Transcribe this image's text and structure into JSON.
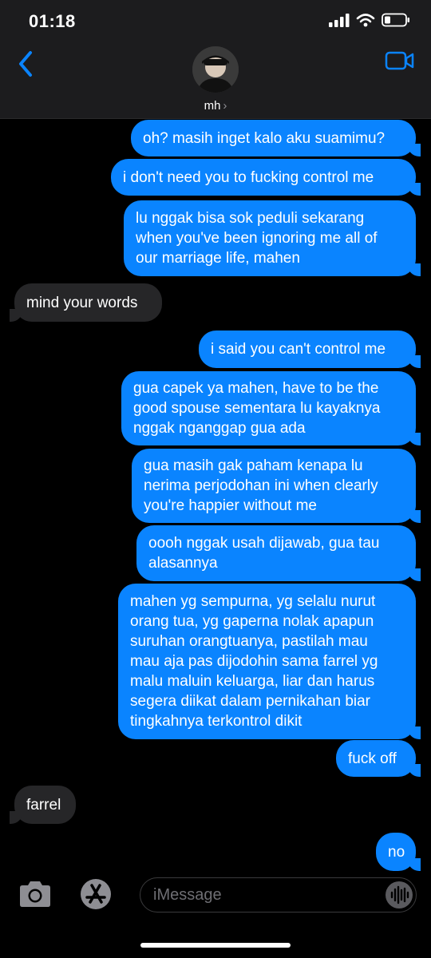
{
  "status": {
    "time": "01:18"
  },
  "header": {
    "contact_name": "mh"
  },
  "messages": [
    {
      "from": "me",
      "lines": [
        "oh? masih inget kalo aku suamimu?"
      ]
    },
    {
      "from": "me",
      "lines": [
        "i don't need you to fucking control me"
      ]
    },
    {
      "from": "me",
      "lines": [
        "lu nggak bisa sok peduli sekarang",
        "when you've been ignoring me all of",
        "our marriage life, mahen"
      ]
    },
    {
      "from": "them",
      "lines": [
        "mind your words"
      ]
    },
    {
      "from": "me",
      "lines": [
        "i said you can't control me"
      ]
    },
    {
      "from": "me",
      "lines": [
        "gua capek ya mahen, have to be the",
        "good spouse sementara lu kayaknya",
        "nggak nganggap gua ada"
      ]
    },
    {
      "from": "me",
      "lines": [
        "gua masih gak paham kenapa lu",
        "nerima perjodohan ini when clearly",
        "you're happier without me"
      ]
    },
    {
      "from": "me",
      "lines": [
        "oooh nggak usah dijawab, gua tau",
        "alasannya"
      ]
    },
    {
      "from": "me",
      "lines": [
        "mahen yg sempurna, yg selalu nurut",
        "orang tua, yg gaperna nolak apapun",
        "suruhan orangtuanya, pastilah mau",
        "mau aja pas dijodohin sama farrel yg",
        "malu maluin keluarga, liar dan harus",
        "segera diikat dalam pernikahan biar",
        "tingkahnya terkontrol dikit"
      ]
    },
    {
      "from": "me",
      "lines": [
        "fuck off"
      ]
    },
    {
      "from": "them",
      "lines": [
        "farrel"
      ]
    },
    {
      "from": "me",
      "lines": [
        "no"
      ]
    }
  ],
  "composer": {
    "placeholder": "iMessage"
  },
  "colors": {
    "sent": "#0a84ff",
    "received": "#262628",
    "accent": "#0a84ff"
  },
  "icons": {
    "back": "chevron-left-icon",
    "video": "video-camera-icon",
    "camera": "camera-icon",
    "apps": "app-store-icon",
    "audio": "audio-waveform-icon"
  }
}
